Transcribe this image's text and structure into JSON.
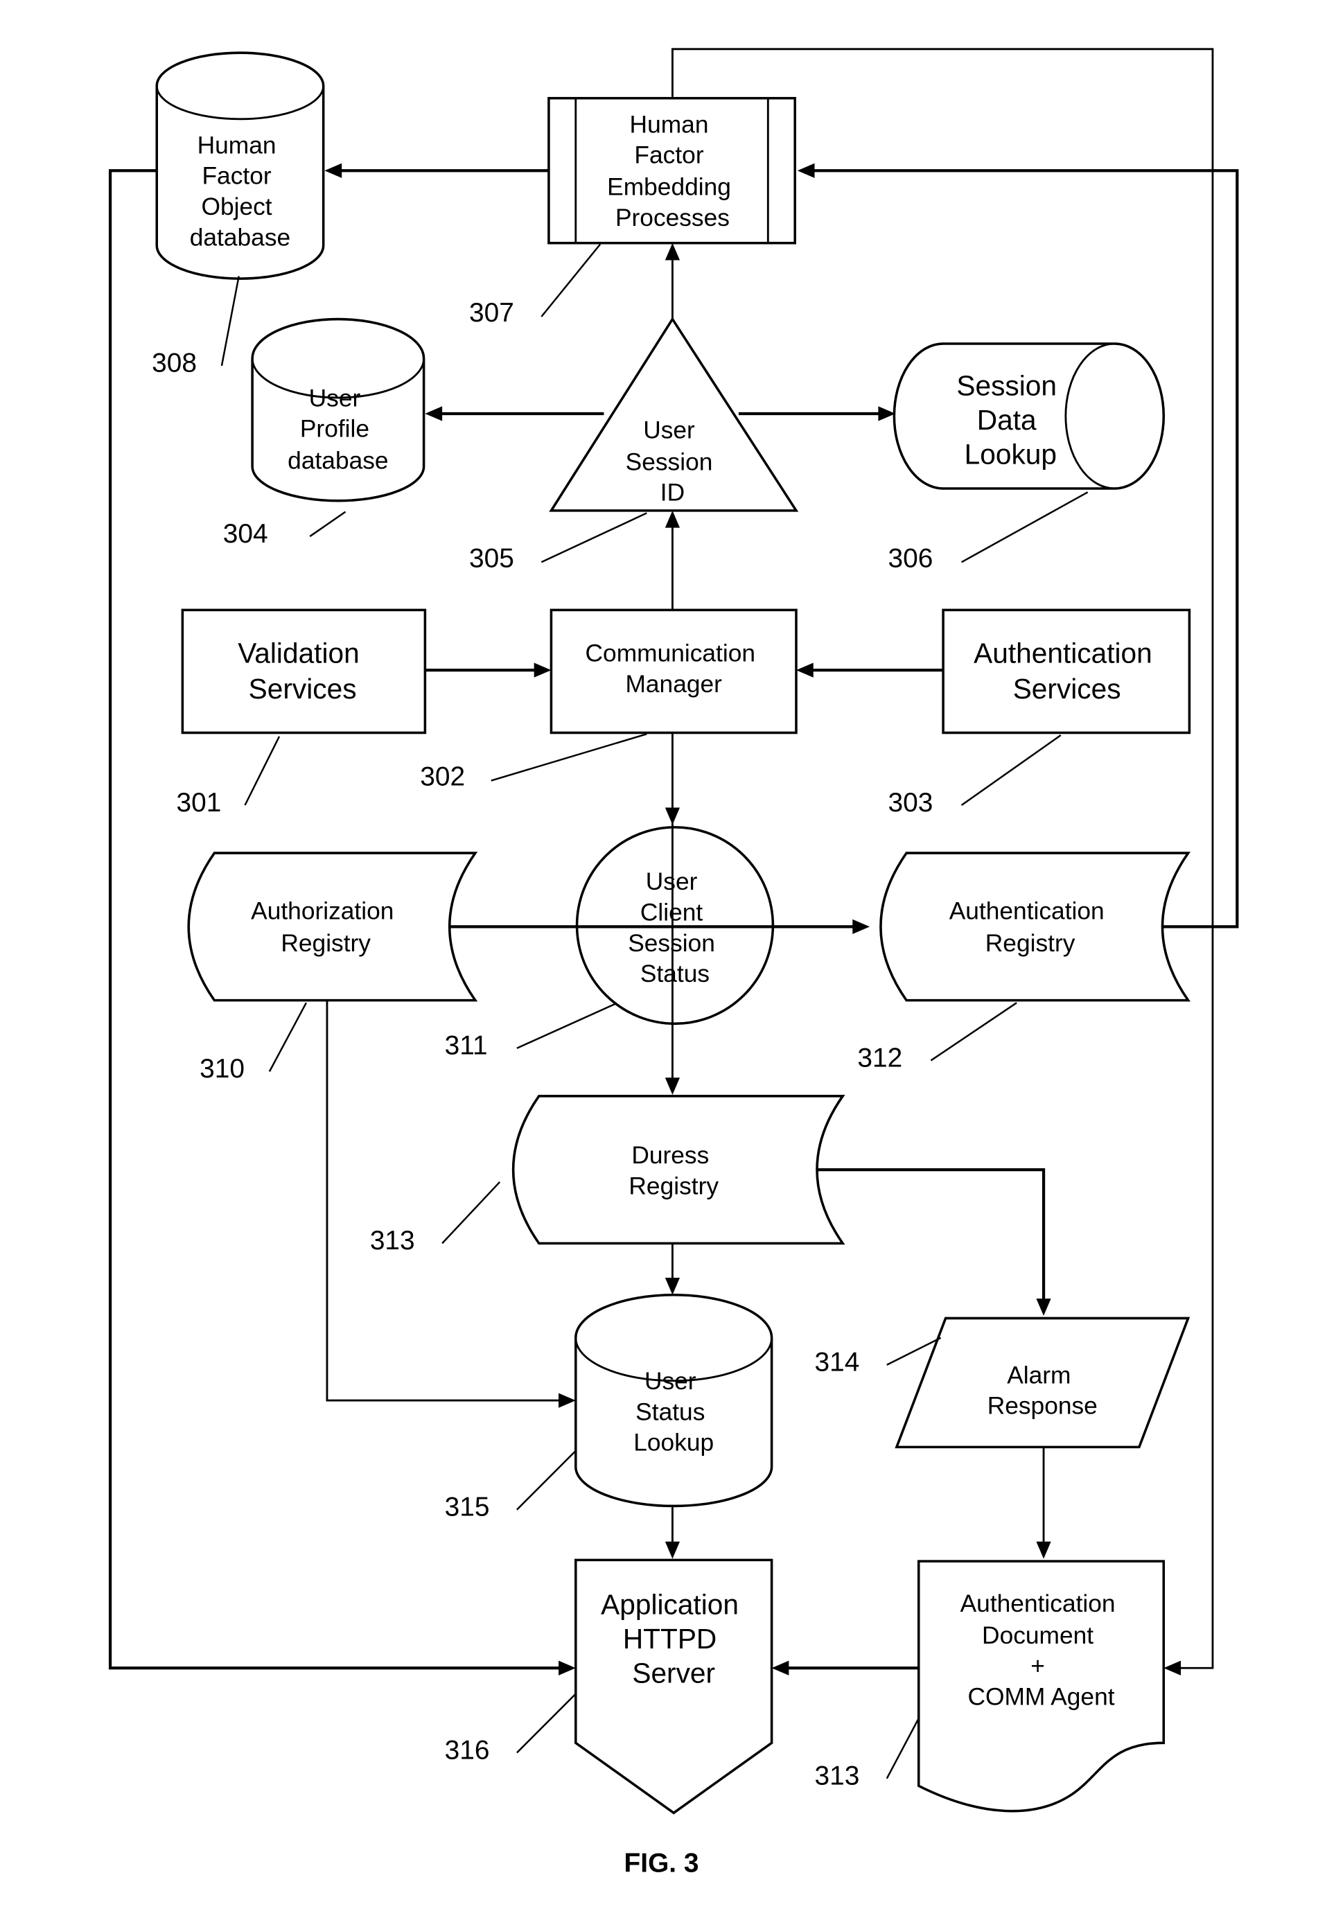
{
  "figure": {
    "caption": "FIG. 3",
    "colors": {
      "line": "#000000",
      "background": "#ffffff"
    }
  },
  "nodes": {
    "human_factor_object_db": {
      "ref": "308",
      "shape": "cylinder",
      "lines": [
        "Human",
        "Factor",
        "Object",
        "database"
      ]
    },
    "human_factor_embedding": {
      "ref": "307",
      "shape": "predefined-process",
      "lines": [
        "Human",
        "Factor",
        "Embedding",
        "Processes"
      ]
    },
    "user_profile_db": {
      "ref": "304",
      "shape": "cylinder",
      "lines": [
        "User",
        "Profile",
        "database"
      ]
    },
    "user_session_id": {
      "ref": "305",
      "shape": "triangle",
      "lines": [
        "User",
        "Session",
        "ID"
      ]
    },
    "session_data_lookup": {
      "ref": "306",
      "shape": "horizontal-cylinder",
      "lines": [
        "Session",
        "Data",
        "Lookup"
      ]
    },
    "validation_services": {
      "ref": "301",
      "shape": "rectangle",
      "lines": [
        "Validation",
        "Services"
      ]
    },
    "communication_manager": {
      "ref": "302",
      "shape": "rectangle",
      "lines": [
        "Communication",
        "Manager"
      ]
    },
    "authentication_services": {
      "ref": "303",
      "shape": "rectangle",
      "lines": [
        "Authentication",
        "Services"
      ]
    },
    "authorization_registry": {
      "ref": "310",
      "shape": "stored-data",
      "lines": [
        "Authorization",
        "Registry"
      ]
    },
    "user_client_session_status": {
      "ref": "311",
      "shape": "ellipse",
      "lines": [
        "User",
        "Client",
        "Session",
        "Status"
      ]
    },
    "authentication_registry": {
      "ref": "312",
      "shape": "stored-data",
      "lines": [
        "Authentication",
        "Registry"
      ]
    },
    "duress_registry": {
      "ref": "313",
      "shape": "stored-data",
      "lines": [
        "Duress",
        "Registry"
      ]
    },
    "alarm_response": {
      "ref": "314",
      "shape": "parallelogram",
      "lines": [
        "Alarm",
        "Response"
      ]
    },
    "user_status_lookup": {
      "ref": "315",
      "shape": "cylinder",
      "lines": [
        "User",
        "Status",
        "Lookup"
      ]
    },
    "application_httpd_server": {
      "ref": "316",
      "shape": "off-page-connector",
      "lines": [
        "Application",
        "HTTPD",
        "Server"
      ]
    },
    "authentication_document": {
      "ref": "313",
      "shape": "document",
      "lines": [
        "Authentication",
        "Document",
        "+",
        "COMM Agent"
      ]
    }
  },
  "edges": [
    {
      "from": "human_factor_embedding",
      "to": "human_factor_object_db"
    },
    {
      "from": "user_session_id",
      "to": "human_factor_embedding"
    },
    {
      "from": "user_session_id",
      "to": "user_profile_db"
    },
    {
      "from": "user_session_id",
      "to": "session_data_lookup"
    },
    {
      "from": "communication_manager",
      "to": "user_session_id"
    },
    {
      "from": "validation_services",
      "to": "communication_manager"
    },
    {
      "from": "authentication_services",
      "to": "communication_manager"
    },
    {
      "from": "communication_manager",
      "to": "duress_registry"
    },
    {
      "from": "user_client_session_status",
      "to": "authorization_registry"
    },
    {
      "from": "user_client_session_status",
      "to": "authentication_registry"
    },
    {
      "from": "authentication_registry",
      "to": "human_factor_embedding"
    },
    {
      "from": "human_factor_embedding",
      "to": "authentication_document"
    },
    {
      "from": "duress_registry",
      "to": "user_status_lookup"
    },
    {
      "from": "duress_registry",
      "to": "alarm_response"
    },
    {
      "from": "authorization_registry",
      "to": "user_status_lookup"
    },
    {
      "from": "alarm_response",
      "to": "authentication_document"
    },
    {
      "from": "user_status_lookup",
      "to": "application_httpd_server"
    },
    {
      "from": "authentication_document",
      "to": "application_httpd_server"
    },
    {
      "from": "human_factor_object_db",
      "to": "application_httpd_server"
    }
  ]
}
